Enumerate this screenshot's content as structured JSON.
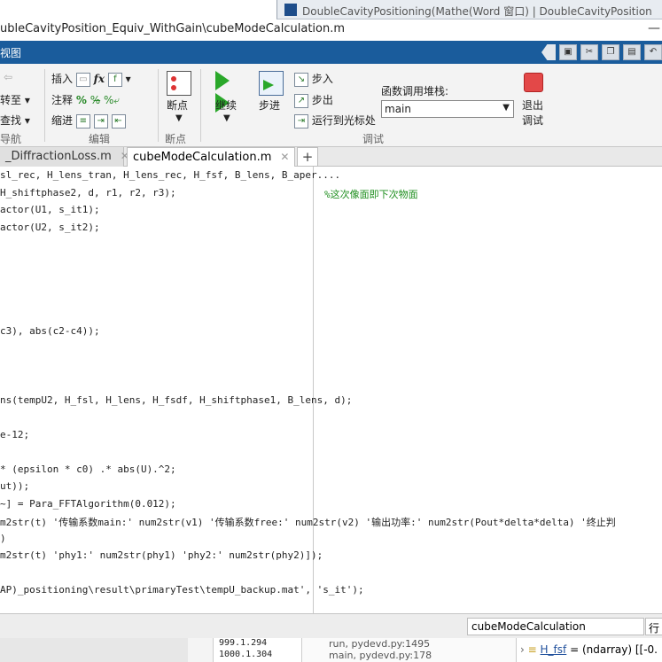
{
  "background_window": {
    "title": "DoubleCavityPositioning(Mathe(Word 窗口) | DoubleCavityPosition"
  },
  "window": {
    "title": "ubleCavityPosition_Equiv_WithGain\\cubeModeCalculation.m"
  },
  "ribbon_tab": "视图",
  "ribbon": {
    "nav": {
      "goto": "转至",
      "find": "查找",
      "group": "导航"
    },
    "edit": {
      "insert": "插入",
      "comment": "注释",
      "indent": "缩进",
      "group": "编辑"
    },
    "breakpoints": {
      "label": "断点",
      "group": "断点"
    },
    "debug": {
      "continue": "继续",
      "step": "步进",
      "step_in": "步入",
      "step_out": "步出",
      "run_to_cursor": "运行到光标处",
      "call_stack_label": "函数调用堆栈:",
      "call_stack_value": "main",
      "quit_line1": "退出",
      "quit_line2": "调试",
      "group": "调试"
    }
  },
  "file_tabs": [
    {
      "label": "_DiffractionLoss.m",
      "active": false
    },
    {
      "label": "cubeModeCalculation.m",
      "active": true
    }
  ],
  "code_lines": [
    {
      "text": "sl_rec, H_lens_tran, H_lens_rec, H_fsf, B_lens, B_aper....",
      "comment": ""
    },
    {
      "text": "H_shiftphase2, d, r1, r2, r3);",
      "comment": "%这次像面即下次物面"
    },
    {
      "text": "actor(U1, s_it1);",
      "comment": ""
    },
    {
      "text": "actor(U2, s_it2);",
      "comment": ""
    },
    {
      "text": "",
      "comment": ""
    },
    {
      "text": "",
      "comment": ""
    },
    {
      "text": "",
      "comment": ""
    },
    {
      "text": "",
      "comment": ""
    },
    {
      "text": "",
      "comment": ""
    },
    {
      "text": "c3), abs(c2-c4));",
      "comment": ""
    },
    {
      "text": "",
      "comment": ""
    },
    {
      "text": "",
      "comment": ""
    },
    {
      "text": "",
      "comment": ""
    },
    {
      "text": "ns(tempU2, H_fsl, H_lens, H_fsdf, H_shiftphase1, B_lens, d);",
      "comment": ""
    },
    {
      "text": "",
      "comment": ""
    },
    {
      "text": "e-12;",
      "comment": ""
    },
    {
      "text": "",
      "comment": ""
    },
    {
      "text": "* (epsilon * c0) .* abs(U).^2;",
      "comment": ""
    },
    {
      "text": "ut));",
      "comment": ""
    },
    {
      "text": "~] = Para_FFTAlgorithm(0.012);",
      "comment": ""
    },
    {
      "text": "m2str(t) '传输系数main:' num2str(v1) '传输系数free:' num2str(v2) '输出功率:' num2str(Pout*delta*delta) '终止判",
      "comment": ""
    },
    {
      "text": ")",
      "comment": ""
    },
    {
      "text": "m2str(t) 'phy1:' num2str(phy1) 'phy2:' num2str(phy2)]);",
      "comment": ""
    },
    {
      "text": "",
      "comment": ""
    },
    {
      "text": "AP)_positioning\\result\\primaryTest\\tempU_backup.mat', 's_it');",
      "comment": ""
    }
  ],
  "status": {
    "function_name": "cubeModeCalculation",
    "row_label": "行"
  },
  "bottom": {
    "values": [
      "999.1.294",
      "1000.1.304"
    ],
    "stack": [
      "run, pydevd.py:1495",
      "main, pydevd.py:178"
    ],
    "variable": {
      "name": "H_fsf",
      "type": "= (ndarray) [[-0."
    }
  }
}
